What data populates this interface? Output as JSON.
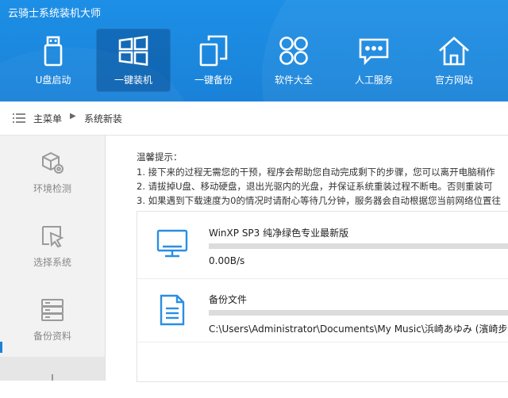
{
  "app": {
    "title": "云骑士系统装机大师"
  },
  "nav": [
    {
      "label": "U盘启动",
      "icon": "usb-drive-icon",
      "active": false
    },
    {
      "label": "一键装机",
      "icon": "windows-icon",
      "active": true
    },
    {
      "label": "一键备份",
      "icon": "backup-icon",
      "active": false
    },
    {
      "label": "软件大全",
      "icon": "apps-grid-icon",
      "active": false
    },
    {
      "label": "人工服务",
      "icon": "chat-icon",
      "active": false
    },
    {
      "label": "官方网站",
      "icon": "home-icon",
      "active": false
    }
  ],
  "breadcrumb": {
    "root": "主菜单",
    "current": "系统新装"
  },
  "sidebar": [
    {
      "label": "环境检测",
      "icon": "environment-check-icon"
    },
    {
      "label": "选择系统",
      "icon": "select-cursor-icon"
    },
    {
      "label": "备份资料",
      "icon": "server-backup-icon"
    }
  ],
  "tips": {
    "title": "温馨提示：",
    "lines": [
      "1. 接下来的过程无需您的干预，程序会帮助您自动完成剩下的步骤，您可以离开电脑稍作",
      "2. 请拔掉U盘、移动硬盘，退出光驱内的光盘，并保证系统重装过程不断电。否则重装可",
      "3. 如果遇到下载速度为0的情况时请耐心等待几分钟，服务器会自动根据您当前网络位置往"
    ]
  },
  "tasks": [
    {
      "name": "WinXP SP3 纯净绿色专业最新版",
      "sub": "0.00B/s",
      "progress": 0,
      "icon": "monitor-icon"
    },
    {
      "name": "备份文件",
      "sub": "C:\\Users\\Administrator\\Documents\\My Music\\浜崎あゆみ (濱崎步)",
      "progress": 0,
      "icon": "document-icon"
    }
  ],
  "colors": {
    "header": "#1a82d8",
    "accent": "#2a8ee4",
    "sidebar": "#f2f2f2"
  }
}
